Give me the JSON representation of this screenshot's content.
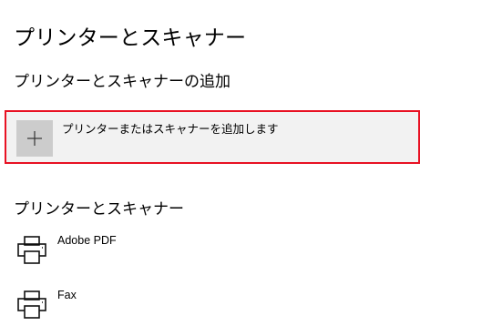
{
  "page": {
    "title": "プリンターとスキャナー"
  },
  "add_section": {
    "title": "プリンターとスキャナーの追加",
    "button_label": "プリンターまたはスキャナーを追加します",
    "icon": "plus-icon",
    "highlight_color": "#e81123"
  },
  "devices_section": {
    "title": "プリンターとスキャナー",
    "items": [
      {
        "name": "Adobe PDF",
        "icon": "printer-icon"
      },
      {
        "name": "Fax",
        "icon": "printer-icon"
      }
    ]
  }
}
